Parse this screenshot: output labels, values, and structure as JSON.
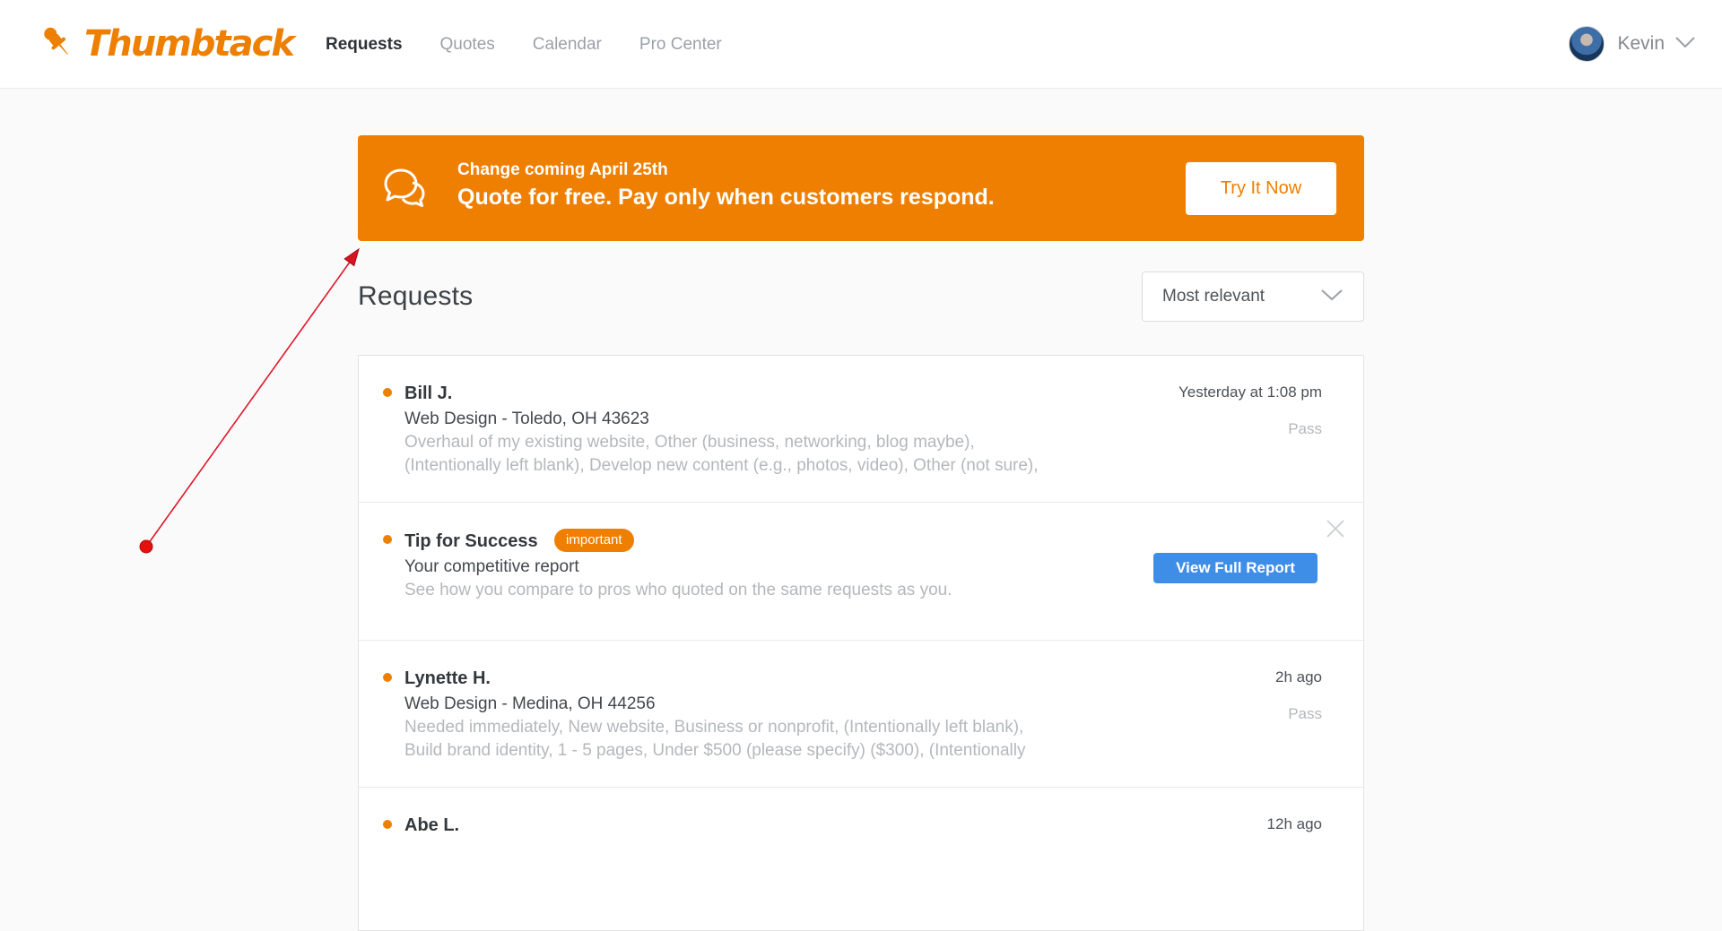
{
  "header": {
    "brand": "Thumbtack",
    "nav": [
      {
        "label": "Requests",
        "active": true
      },
      {
        "label": "Quotes",
        "active": false
      },
      {
        "label": "Calendar",
        "active": false
      },
      {
        "label": "Pro Center",
        "active": false
      }
    ],
    "user": {
      "name": "Kevin"
    }
  },
  "banner": {
    "title": "Change coming April 25th",
    "subtitle": "Quote for free. Pay only when customers respond.",
    "cta": "Try It Now"
  },
  "page": {
    "title": "Requests",
    "sort_value": "Most relevant"
  },
  "rows": [
    {
      "name": "Bill J.",
      "subtitle": "Web Design - Toledo, OH 43623",
      "desc1": "Overhaul of my existing website, Other (business, networking, blog maybe),",
      "desc2": "(Intentionally left blank), Develop new content (e.g., photos, video), Other (not sure),",
      "timestamp": "Yesterday at 1:08 pm",
      "action": "Pass"
    },
    {
      "name": "Tip for Success",
      "badge": "important",
      "subtitle": "Your competitive report",
      "desc1": "See how you compare to pros who quoted on the same requests as you.",
      "cta": "View Full Report"
    },
    {
      "name": "Lynette H.",
      "subtitle": "Web Design - Medina, OH 44256",
      "desc1": "Needed immediately, New website, Business or nonprofit, (Intentionally left blank),",
      "desc2": "Build brand identity, 1 - 5 pages, Under $500 (please specify) ($300), (Intentionally",
      "timestamp": "2h ago",
      "action": "Pass"
    },
    {
      "name": "Abe L.",
      "timestamp": "12h ago"
    }
  ],
  "colors": {
    "brand_orange": "#EE7F01",
    "cta_blue": "#3E8EE8",
    "annotation_red": "#E0162B"
  }
}
